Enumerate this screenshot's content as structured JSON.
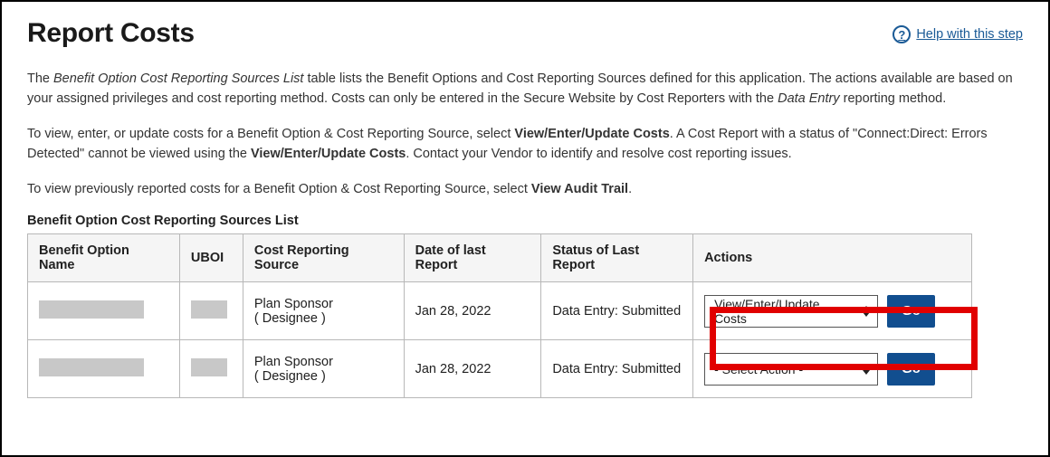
{
  "header": {
    "title": "Report Costs",
    "help_label": "Help with this step"
  },
  "intro": {
    "p1_html": "The <em>Benefit Option Cost Reporting Sources List</em> table lists the Benefit Options and Cost Reporting Sources defined for this application. The actions available are based on your assigned privileges and cost reporting method. Costs can only be entered in the Secure Website by Cost Reporters with the <em>Data Entry</em> reporting method.",
    "p2_html": "To view, enter, or update costs for a Benefit Option & Cost Reporting Source, select <b>View/Enter/Update Costs</b>. A Cost Report with a status of \"Connect:Direct: Errors Detected\" cannot be viewed using the <b>View/Enter/Update Costs</b>. Contact your Vendor to identify and resolve cost reporting issues.",
    "p3_html": "To view previously reported costs for a Benefit Option & Cost Reporting Source, select <b>View Audit Trail</b>."
  },
  "table": {
    "caption": "Benefit Option Cost Reporting Sources List",
    "columns": {
      "c0": "Benefit Option Name",
      "c1": "UBOI",
      "c2": "Cost Reporting Source",
      "c3": "Date of last Report",
      "c4": "Status of Last Report",
      "c5": "Actions"
    },
    "rows": [
      {
        "source_line1": "Plan Sponsor",
        "source_line2": "( Designee )",
        "date": "Jan 28, 2022",
        "status": "Data Entry: Submitted",
        "action_selected": "View/Enter/Update Costs",
        "go_label": "Go"
      },
      {
        "source_line1": "Plan Sponsor",
        "source_line2": "( Designee )",
        "date": "Jan 28, 2022",
        "status": "Data Entry: Submitted",
        "action_selected": "- Select Action -",
        "go_label": "Go"
      }
    ]
  }
}
